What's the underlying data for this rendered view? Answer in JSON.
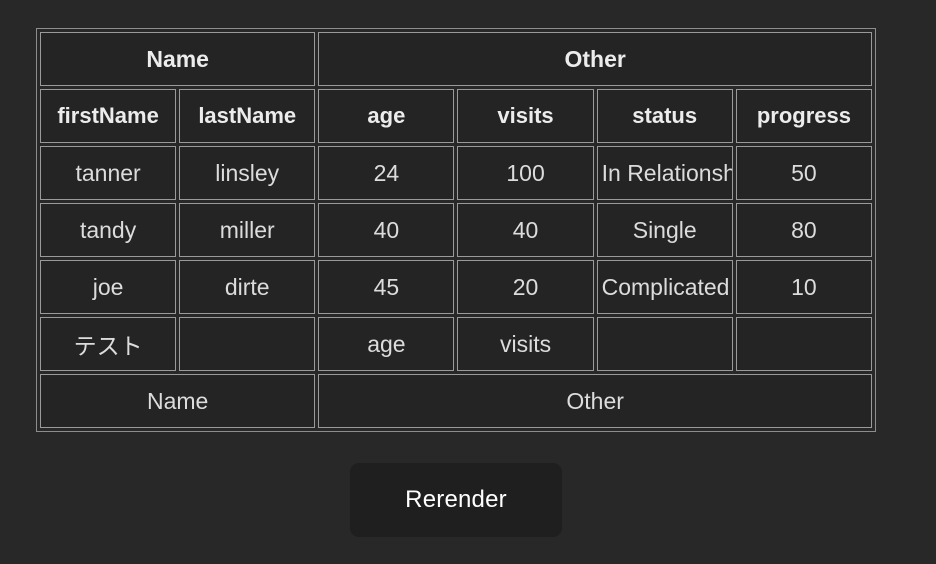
{
  "table": {
    "group_headers": [
      {
        "label": "Name",
        "colspan": 2
      },
      {
        "label": "Other",
        "colspan": 4
      }
    ],
    "columns": [
      {
        "key": "firstName",
        "label": "firstName"
      },
      {
        "key": "lastName",
        "label": "lastName"
      },
      {
        "key": "age",
        "label": "age"
      },
      {
        "key": "visits",
        "label": "visits"
      },
      {
        "key": "status",
        "label": "status"
      },
      {
        "key": "progress",
        "label": "progress"
      }
    ],
    "rows": [
      {
        "firstName": "tanner",
        "lastName": "linsley",
        "age": "24",
        "visits": "100",
        "status": "In Relationship",
        "progress": "50"
      },
      {
        "firstName": "tandy",
        "lastName": "miller",
        "age": "40",
        "visits": "40",
        "status": "Single",
        "progress": "80"
      },
      {
        "firstName": "joe",
        "lastName": "dirte",
        "age": "45",
        "visits": "20",
        "status": "Complicated",
        "progress": "10"
      }
    ],
    "footer_columns": [
      {
        "key": "firstName",
        "label": "テスト"
      },
      {
        "key": "lastName",
        "label": ""
      },
      {
        "key": "age",
        "label": "age"
      },
      {
        "key": "visits",
        "label": "visits"
      },
      {
        "key": "status",
        "label": ""
      },
      {
        "key": "progress",
        "label": ""
      }
    ],
    "footer_group_headers": [
      {
        "label": "Name",
        "colspan": 2
      },
      {
        "label": "Other",
        "colspan": 4
      }
    ]
  },
  "controls": {
    "rerender_label": "Rerender"
  },
  "colors": {
    "page_background": "#282828",
    "cell_background": "#242424",
    "border": "#9a9a9a",
    "text": "#e8e8e8",
    "button_background": "#1f1f1f",
    "button_text": "#ffffff"
  }
}
